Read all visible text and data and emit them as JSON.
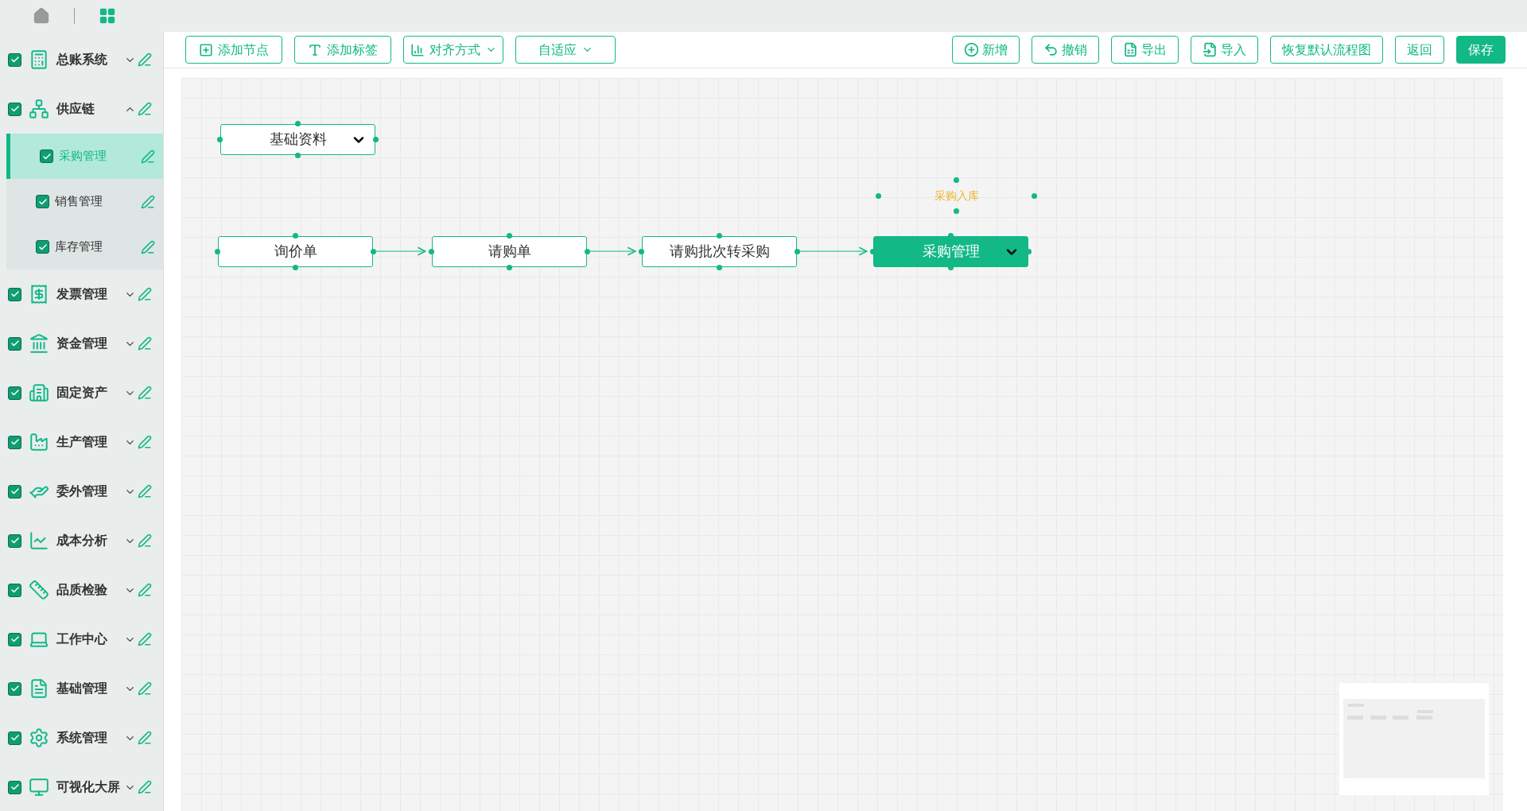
{
  "sidebar": {
    "items": [
      {
        "label": "总账系统",
        "checked": true,
        "expanded": false
      },
      {
        "label": "供应链",
        "checked": true,
        "expanded": true,
        "children": [
          {
            "label": "采购管理",
            "checked": true,
            "selected": true
          },
          {
            "label": "销售管理",
            "checked": true,
            "selected": false
          },
          {
            "label": "库存管理",
            "checked": true,
            "selected": false
          }
        ]
      },
      {
        "label": "发票管理",
        "checked": true,
        "expanded": false
      },
      {
        "label": "资金管理",
        "checked": true,
        "expanded": false
      },
      {
        "label": "固定资产",
        "checked": true,
        "expanded": false
      },
      {
        "label": "生产管理",
        "checked": true,
        "expanded": false
      },
      {
        "label": "委外管理",
        "checked": true,
        "expanded": false
      },
      {
        "label": "成本分析",
        "checked": true,
        "expanded": false
      },
      {
        "label": "品质检验",
        "checked": true,
        "expanded": false
      },
      {
        "label": "工作中心",
        "checked": true,
        "expanded": false
      },
      {
        "label": "基础管理",
        "checked": true,
        "expanded": false
      },
      {
        "label": "系统管理",
        "checked": true,
        "expanded": false
      },
      {
        "label": "可视化大屏",
        "checked": true,
        "expanded": false
      }
    ]
  },
  "toolbar": {
    "left": [
      {
        "label": "添加节点",
        "dropdown": false
      },
      {
        "label": "添加标签",
        "dropdown": false
      },
      {
        "label": "对齐方式",
        "dropdown": true
      },
      {
        "label": "自适应",
        "dropdown": true
      }
    ],
    "right": [
      {
        "label": "新增",
        "kind": "outline"
      },
      {
        "label": "撤销",
        "kind": "outline"
      },
      {
        "label": "导出",
        "kind": "outline"
      },
      {
        "label": "导入",
        "kind": "outline"
      },
      {
        "label": "恢复默认流程图",
        "kind": "outline"
      },
      {
        "label": "返回",
        "kind": "outline"
      },
      {
        "label": "保存",
        "kind": "primary"
      }
    ]
  },
  "canvas": {
    "nodes": [
      {
        "label": "基础资料",
        "selected": false,
        "dropdown": true
      },
      {
        "label": "询价单",
        "selected": false,
        "dropdown": false
      },
      {
        "label": "请购单",
        "selected": false,
        "dropdown": false
      },
      {
        "label": "请购批次转采购",
        "selected": false,
        "dropdown": false
      },
      {
        "label": "采购管理",
        "selected": true,
        "dropdown": true
      }
    ],
    "tag": {
      "label": "采购入库",
      "color": "#f0b429"
    }
  }
}
